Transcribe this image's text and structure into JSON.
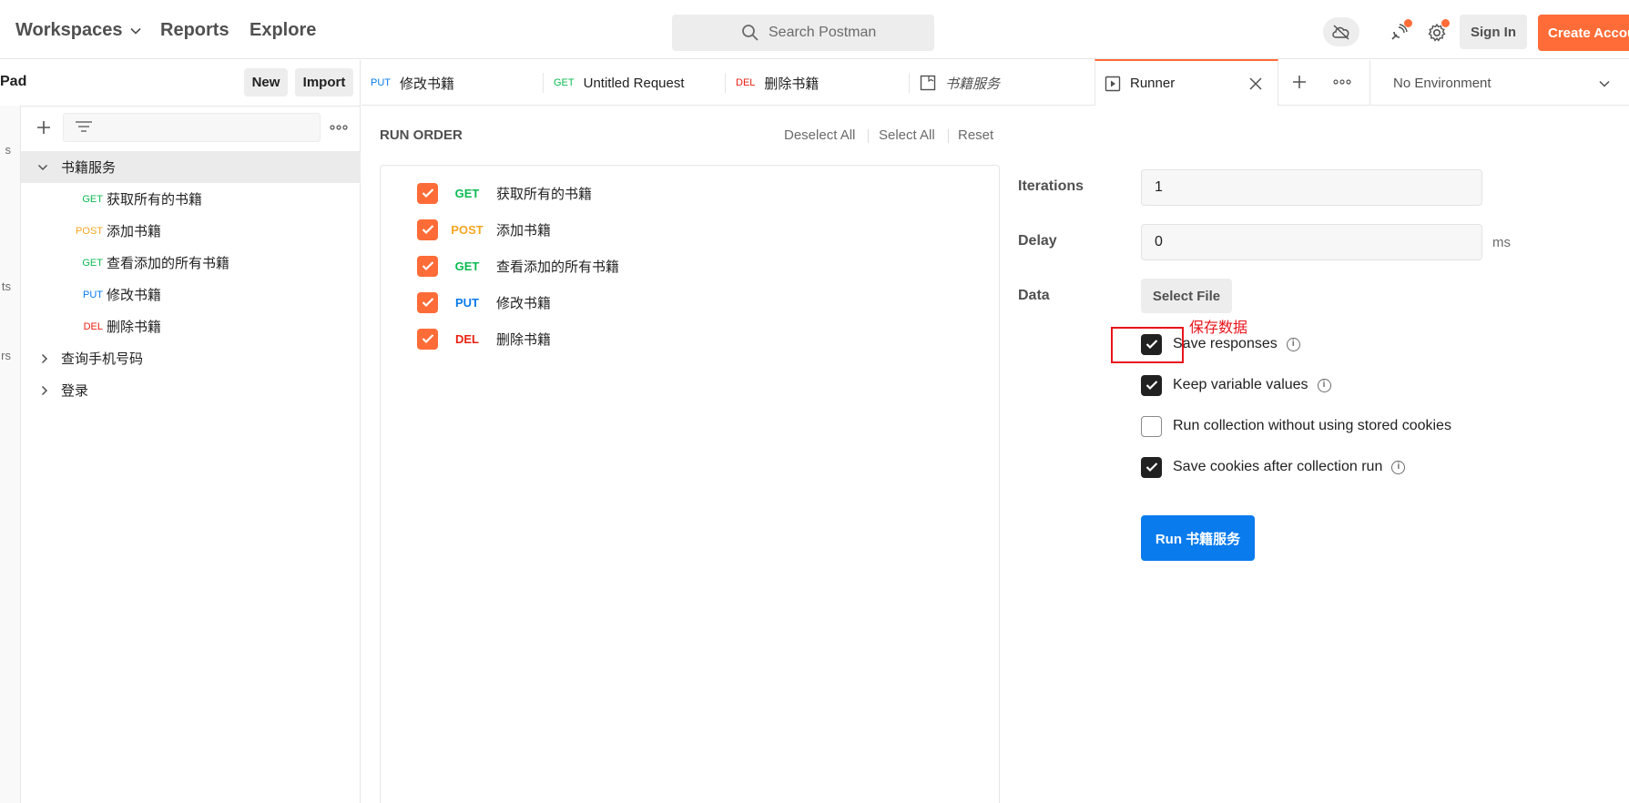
{
  "topbar": {
    "nav": [
      "Workspaces",
      "Reports",
      "Explore"
    ],
    "search_placeholder": "Search Postman",
    "sign_in": "Sign In",
    "create_account": "Create Account"
  },
  "sidebar": {
    "title": "Pad",
    "new_label": "New",
    "import_label": "Import",
    "rail_labels": [
      "s",
      "ts",
      "rs"
    ],
    "tree": [
      {
        "label": "书籍服务",
        "type": "folder",
        "expanded": true
      },
      {
        "method": "GET",
        "label": "获取所有的书籍"
      },
      {
        "method": "POST",
        "label": "添加书籍"
      },
      {
        "method": "GET",
        "label": "查看添加的所有书籍"
      },
      {
        "method": "PUT",
        "label": "修改书籍"
      },
      {
        "method": "DEL",
        "label": "删除书籍"
      },
      {
        "label": "查询手机号码",
        "type": "folder",
        "expanded": false
      },
      {
        "label": "登录",
        "type": "folder",
        "expanded": false
      }
    ]
  },
  "tabs": [
    {
      "method": "PUT",
      "label": "修改书籍"
    },
    {
      "method": "GET",
      "label": "Untitled Request"
    },
    {
      "method": "DEL",
      "label": "删除书籍"
    },
    {
      "method": "",
      "label": "书籍服务"
    },
    {
      "method": "",
      "label": "Runner"
    }
  ],
  "environment": "No Environment",
  "runner": {
    "run_order_title": "RUN ORDER",
    "deselect_all": "Deselect All",
    "select_all": "Select All",
    "reset": "Reset",
    "items": [
      {
        "method": "GET",
        "label": "获取所有的书籍",
        "checked": true
      },
      {
        "method": "POST",
        "label": "添加书籍",
        "checked": true
      },
      {
        "method": "GET",
        "label": "查看添加的所有书籍",
        "checked": true
      },
      {
        "method": "PUT",
        "label": "修改书籍",
        "checked": true
      },
      {
        "method": "DEL",
        "label": "删除书籍",
        "checked": true
      }
    ],
    "iterations_label": "Iterations",
    "iterations_value": "1",
    "delay_label": "Delay",
    "delay_value": "0",
    "delay_unit": "ms",
    "data_label": "Data",
    "select_file": "Select File",
    "options": [
      {
        "label": "Save responses",
        "checked": true,
        "info": true
      },
      {
        "label": "Keep variable values",
        "checked": true,
        "info": true
      },
      {
        "label": "Run collection without using stored cookies",
        "checked": false,
        "info": false
      },
      {
        "label": "Save cookies after collection run",
        "checked": true,
        "info": true
      }
    ],
    "run_button": "Run 书籍服务"
  },
  "annotation": {
    "text": "保存数据",
    "color": "#e8141c"
  },
  "colors": {
    "accent": "#ff6c37",
    "primary_blue": "#097bed",
    "get": "#0cbb52",
    "post": "#f5a623",
    "put": "#097bed",
    "del": "#eb2013"
  }
}
